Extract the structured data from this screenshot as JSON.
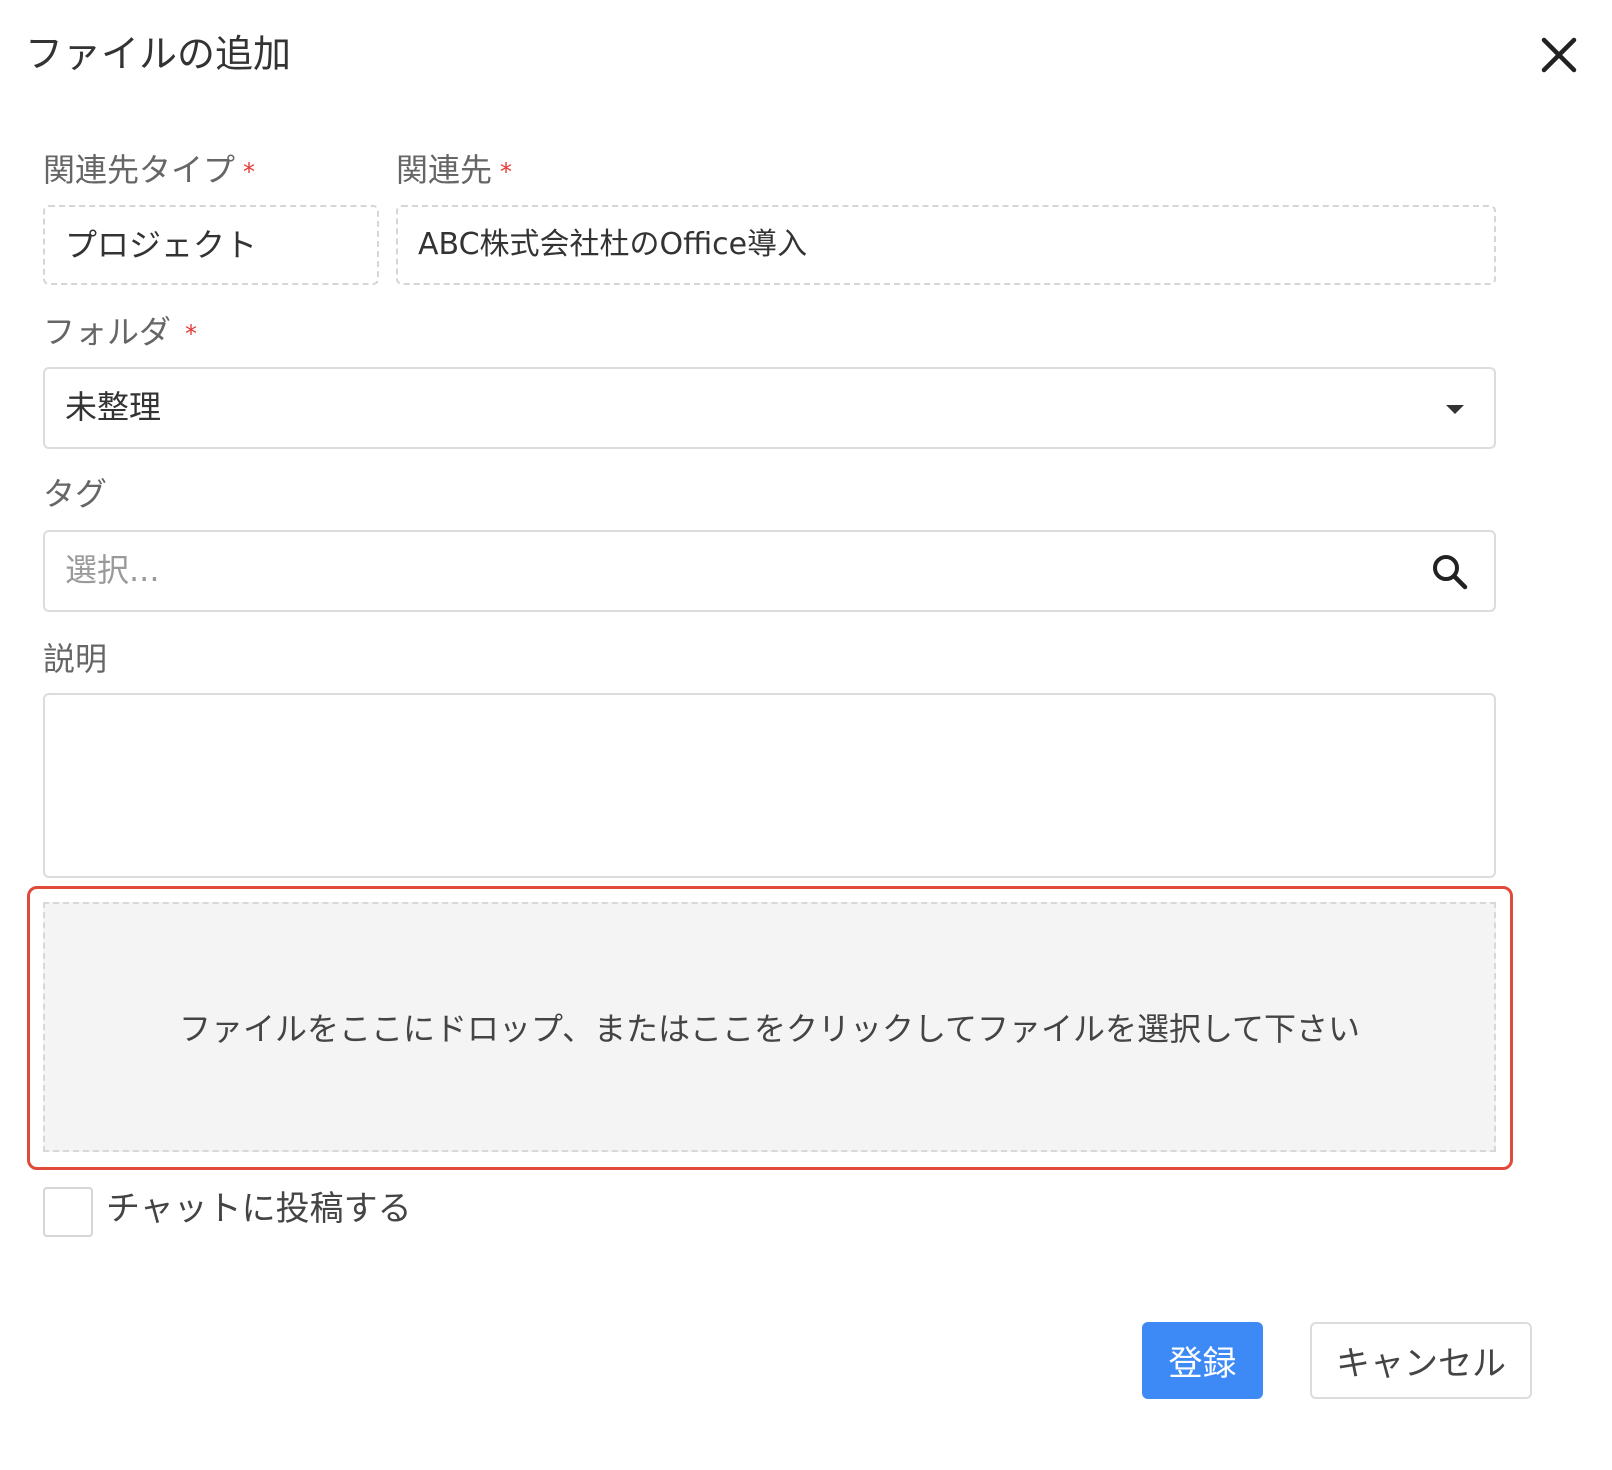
{
  "dialog": {
    "title": "ファイルの追加",
    "close_icon": "close-icon"
  },
  "form": {
    "related_type": {
      "label": "関連先タイプ",
      "required_mark": "*",
      "value": "プロジェクト"
    },
    "related_to": {
      "label": "関連先",
      "required_mark": "*",
      "value": "ABC株式会社杜のOffice導入"
    },
    "folder": {
      "label": "フォルダ",
      "required_mark": "*",
      "value": "未整理",
      "icon": "chevron-down-icon"
    },
    "tags": {
      "label": "タグ",
      "placeholder": "選択...",
      "icon": "search-icon"
    },
    "description": {
      "label": "説明",
      "value": ""
    },
    "dropzone": {
      "text": "ファイルをここにドロップ、またはここをクリックしてファイルを選択して下さい"
    },
    "post_to_chat": {
      "label": "チャットに投稿する",
      "checked": false
    }
  },
  "actions": {
    "submit_label": "登録",
    "cancel_label": "キャンセル"
  },
  "colors": {
    "primary": "#3d8af7",
    "required": "#e53935",
    "highlight": "#e04a3b"
  }
}
